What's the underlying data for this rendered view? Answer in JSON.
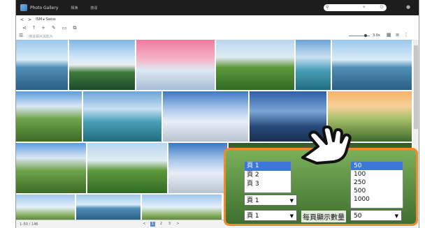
{
  "app": {
    "title": "Photo Gallery",
    "menu": [
      "相簿",
      "搜尋"
    ]
  },
  "nav": {
    "crumb": "ISM ▸ Swiss"
  },
  "filter": {
    "placeholder": "搜尋相片與影片",
    "zoom_label": "3.0x"
  },
  "status": {
    "left": "1–50 / 146",
    "pages": [
      "1",
      "2",
      "3"
    ],
    "active": "1"
  },
  "overlay": {
    "page_list": [
      "頁 1",
      "頁 2",
      "頁 3"
    ],
    "page_list_selected": "頁 1",
    "page_select_1": "頁 1",
    "page_select_2": "頁 1",
    "per_page_label": "每頁顯示數量",
    "per_page_options": [
      "50",
      "100",
      "250",
      "500",
      "1000"
    ],
    "per_page_selected": "50",
    "per_page_value": "50"
  },
  "colors": {
    "highlight": "#f08a2c",
    "select": "#3b78d8"
  }
}
